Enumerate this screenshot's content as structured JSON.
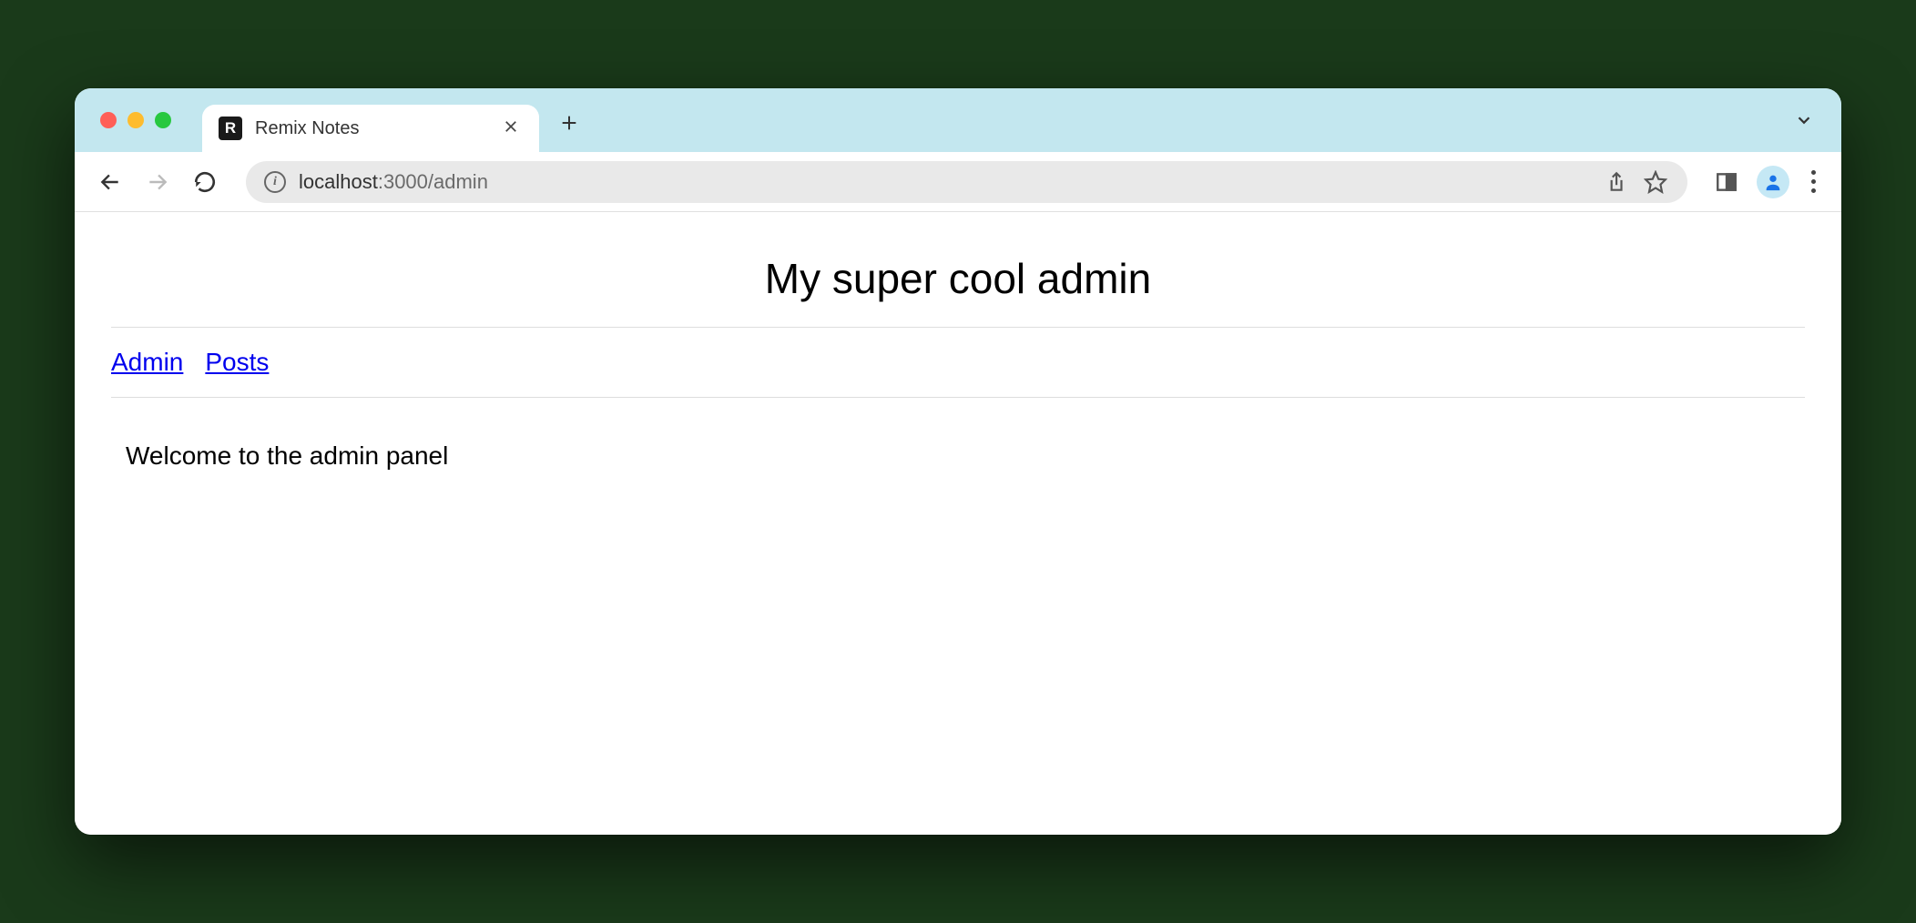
{
  "browser": {
    "tab": {
      "favicon_letter": "R",
      "title": "Remix Notes"
    },
    "address": {
      "host": "localhost",
      "path": ":3000/admin"
    }
  },
  "page": {
    "heading": "My super cool admin",
    "nav": {
      "admin": "Admin",
      "posts": "Posts"
    },
    "welcome": "Welcome to the admin panel"
  }
}
